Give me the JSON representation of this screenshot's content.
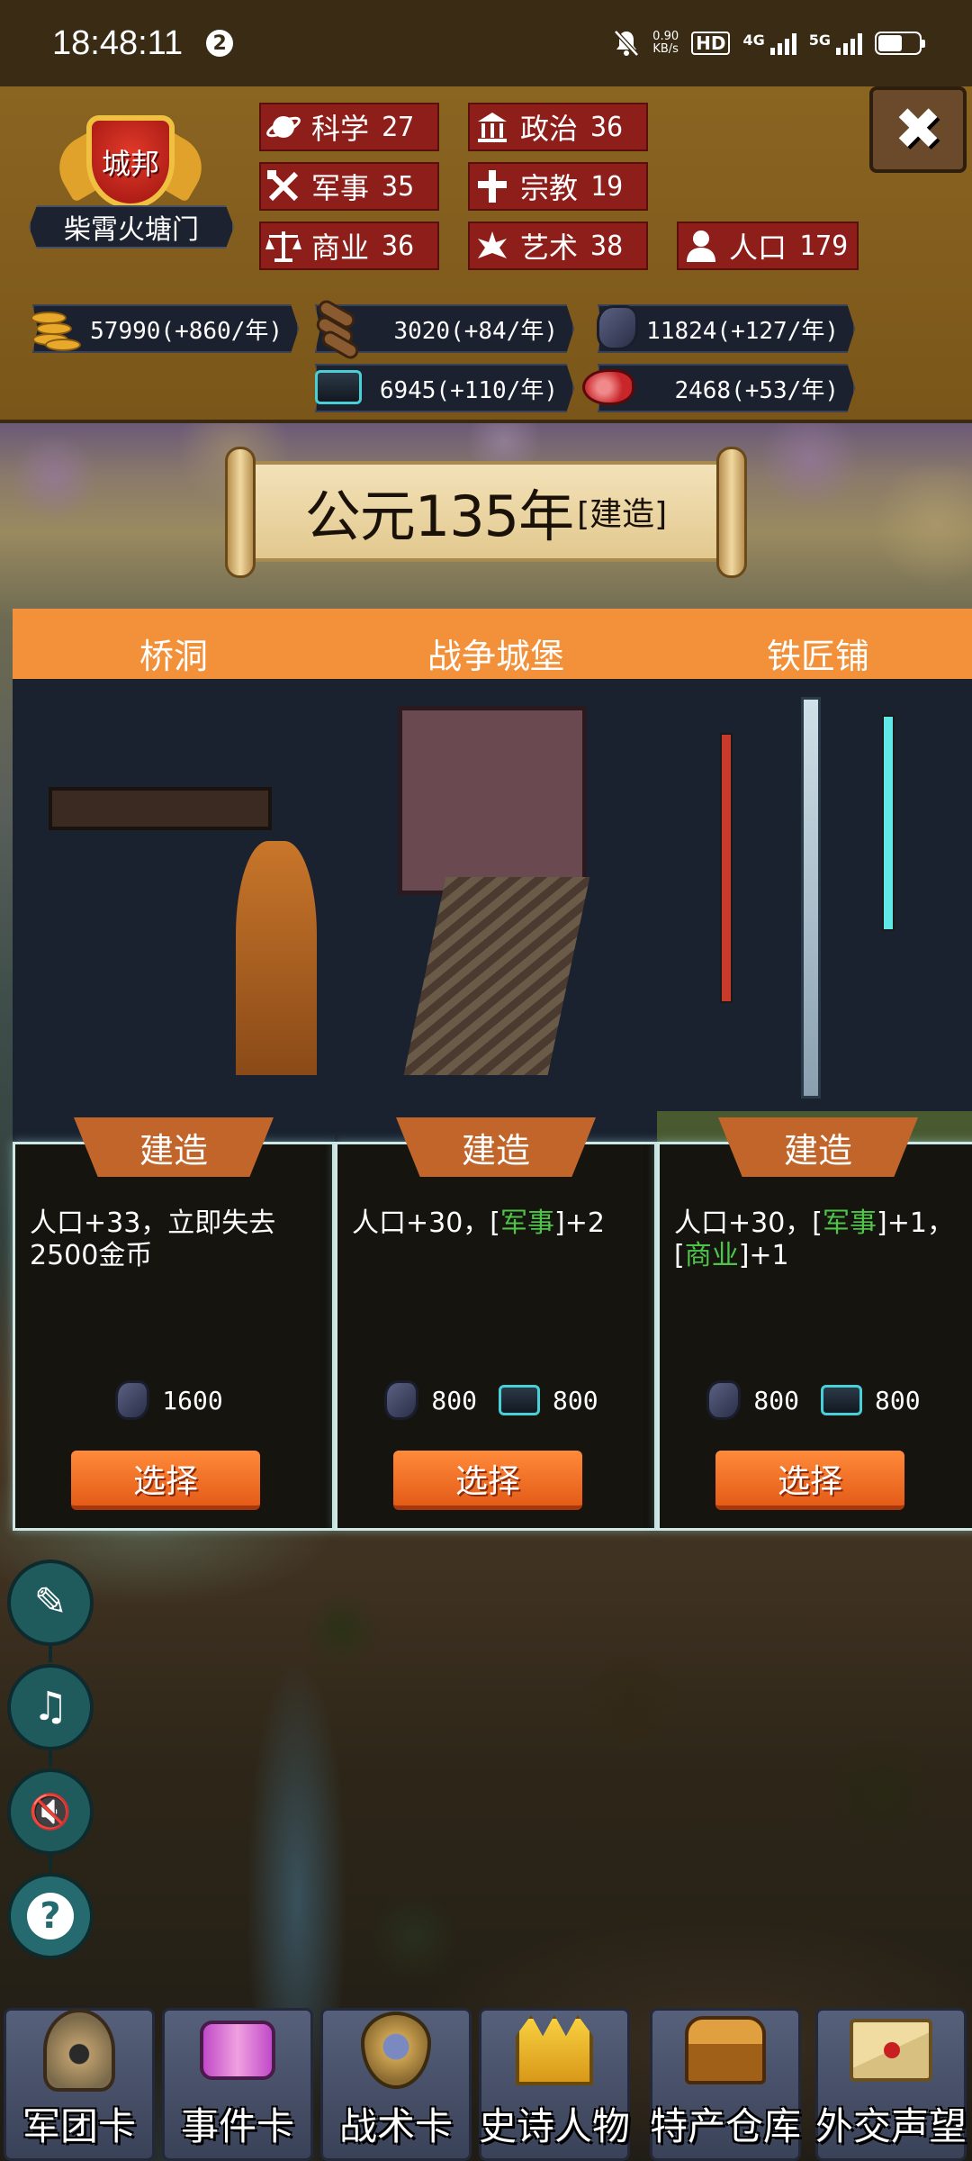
{
  "status_bar": {
    "time": "18:48:11",
    "notification_count": "2",
    "net_speed_value": "0.90",
    "net_speed_unit": "KB/s",
    "hd_label": "HD",
    "sim1_label": "4G",
    "sim2_label": "5G",
    "icons": [
      "mute-icon",
      "signal-icon",
      "battery-icon"
    ]
  },
  "city": {
    "rank": "城邦",
    "name": "柴霄火塘门"
  },
  "stats": [
    {
      "icon": "science-icon",
      "label": "科学",
      "value": "27"
    },
    {
      "icon": "politics-icon",
      "label": "政治",
      "value": "36"
    },
    {
      "icon": "military-icon",
      "label": "军事",
      "value": "35"
    },
    {
      "icon": "religion-icon",
      "label": "宗教",
      "value": "19"
    },
    {
      "icon": "commerce-icon",
      "label": "商业",
      "value": "36"
    },
    {
      "icon": "art-icon",
      "label": "艺术",
      "value": "38"
    },
    {
      "icon": "population-icon",
      "label": "人口",
      "value": "179"
    }
  ],
  "resources": [
    {
      "icon": "gold-coins-icon",
      "text": "57990(+860/年)"
    },
    {
      "icon": "wood-logs-icon",
      "text": "3020(+84/年)"
    },
    {
      "icon": "ore-icon",
      "text": "11824(+127/年)"
    },
    {
      "icon": "machinery-icon",
      "text": "6945(+110/年)"
    },
    {
      "icon": "meat-icon",
      "text": "2468(+53/年)"
    }
  ],
  "close_label": "✖",
  "banner": {
    "year": "公元135年",
    "phase": "[建造]"
  },
  "cards": [
    {
      "title": "桥洞",
      "tag": "建造",
      "desc_parts": [
        "人口+33，立即失去2500金币"
      ],
      "highlights": [],
      "costs": [
        {
          "icon": "ore-icon",
          "amount": "1600"
        }
      ],
      "button": "选择"
    },
    {
      "title": "战争城堡",
      "tag": "建造",
      "desc_parts": [
        "人口+30，[",
        "军事",
        "]+2"
      ],
      "costs": [
        {
          "icon": "ore-icon",
          "amount": "800"
        },
        {
          "icon": "machinery-icon",
          "amount": "800"
        }
      ],
      "button": "选择"
    },
    {
      "title": "铁匠铺",
      "tag": "建造",
      "desc_parts": [
        "人口+30，[",
        "军事",
        "]+1，[",
        "商业",
        "]+1"
      ],
      "costs": [
        {
          "icon": "ore-icon",
          "amount": "800"
        },
        {
          "icon": "machinery-icon",
          "amount": "800"
        }
      ],
      "button": "选择"
    }
  ],
  "side_buttons": [
    {
      "icon": "book-quill-icon",
      "glyph": "✎"
    },
    {
      "icon": "music-off-icon",
      "glyph": "♫"
    },
    {
      "icon": "sound-off-icon",
      "glyph": "🔇"
    },
    {
      "icon": "help-icon",
      "glyph": "?"
    }
  ],
  "nav": [
    {
      "icon": "helmet-icon",
      "label": "军团卡"
    },
    {
      "icon": "scroll-icon",
      "label": "事件卡"
    },
    {
      "icon": "shield-swords-icon",
      "label": "战术卡"
    },
    {
      "icon": "crown-icon",
      "label": "史诗人物"
    },
    {
      "icon": "treasure-chest-icon",
      "label": "特产仓库"
    },
    {
      "icon": "envelope-icon",
      "label": "外交声望"
    }
  ],
  "colors": {
    "header_bg": "#8a6421",
    "stat_bg": "#8e1e1a",
    "resource_bg": "#1c2130",
    "card_title": "#f2913a",
    "card_tag": "#c1652a",
    "highlight": "#4fc34a",
    "select_button": "#ff8a3a",
    "side_button": "#1f5a5c"
  }
}
